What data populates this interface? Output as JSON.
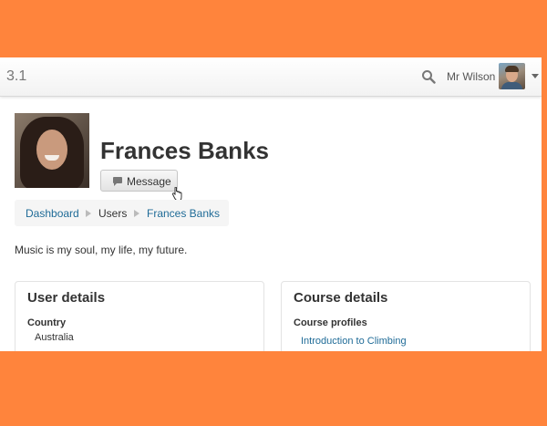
{
  "navbar": {
    "brand": "3.1",
    "user_name": "Mr Wilson"
  },
  "profile": {
    "name": "Frances Banks",
    "message_button": "Message",
    "bio": "Music is my soul, my life, my future."
  },
  "breadcrumb": {
    "items": [
      "Dashboard",
      "Users",
      "Frances Banks"
    ]
  },
  "user_details": {
    "title": "User details",
    "country_label": "Country",
    "country_value": "Australia"
  },
  "course_details": {
    "title": "Course details",
    "profiles_label": "Course profiles",
    "courses": [
      "Introduction to Climbing"
    ]
  },
  "colors": {
    "background": "#ff843c",
    "link": "#1f6b97"
  }
}
